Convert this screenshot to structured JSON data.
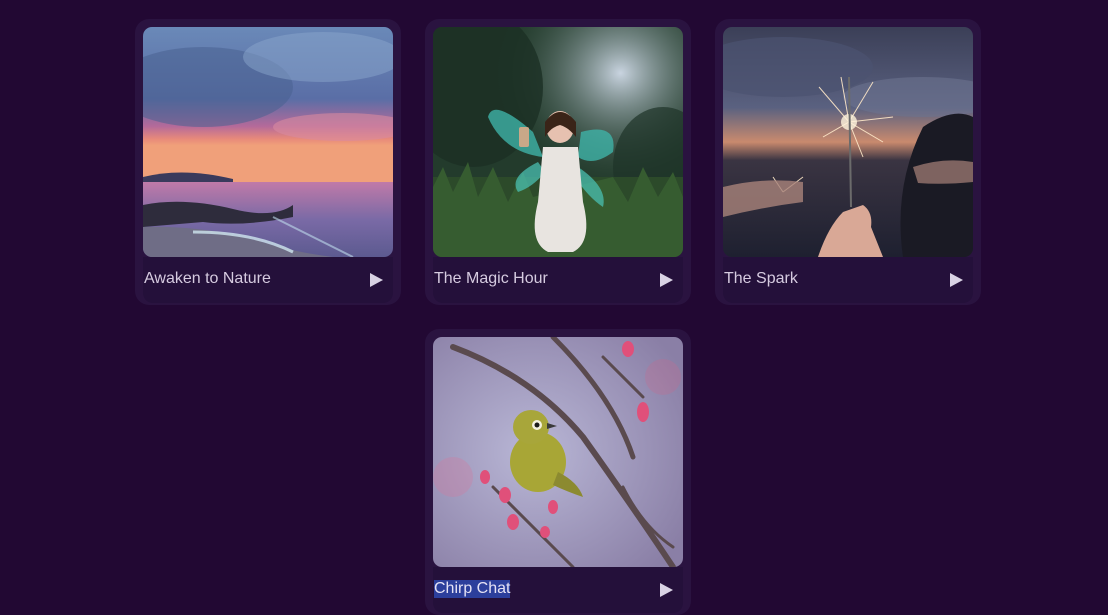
{
  "cards": [
    {
      "title": "Awaken to Nature",
      "icon": "play-icon"
    },
    {
      "title": "The Magic Hour",
      "icon": "play-icon"
    },
    {
      "title": "The Spark",
      "icon": "play-icon"
    },
    {
      "title": "Chirp Chat",
      "icon": "play-icon",
      "selected": true
    }
  ],
  "colors": {
    "background": "#220833",
    "card": "#2a1340",
    "caption_text": "#d6cbe0",
    "selection": "#2c3f9c",
    "play_icon": "#d9d2e4"
  }
}
